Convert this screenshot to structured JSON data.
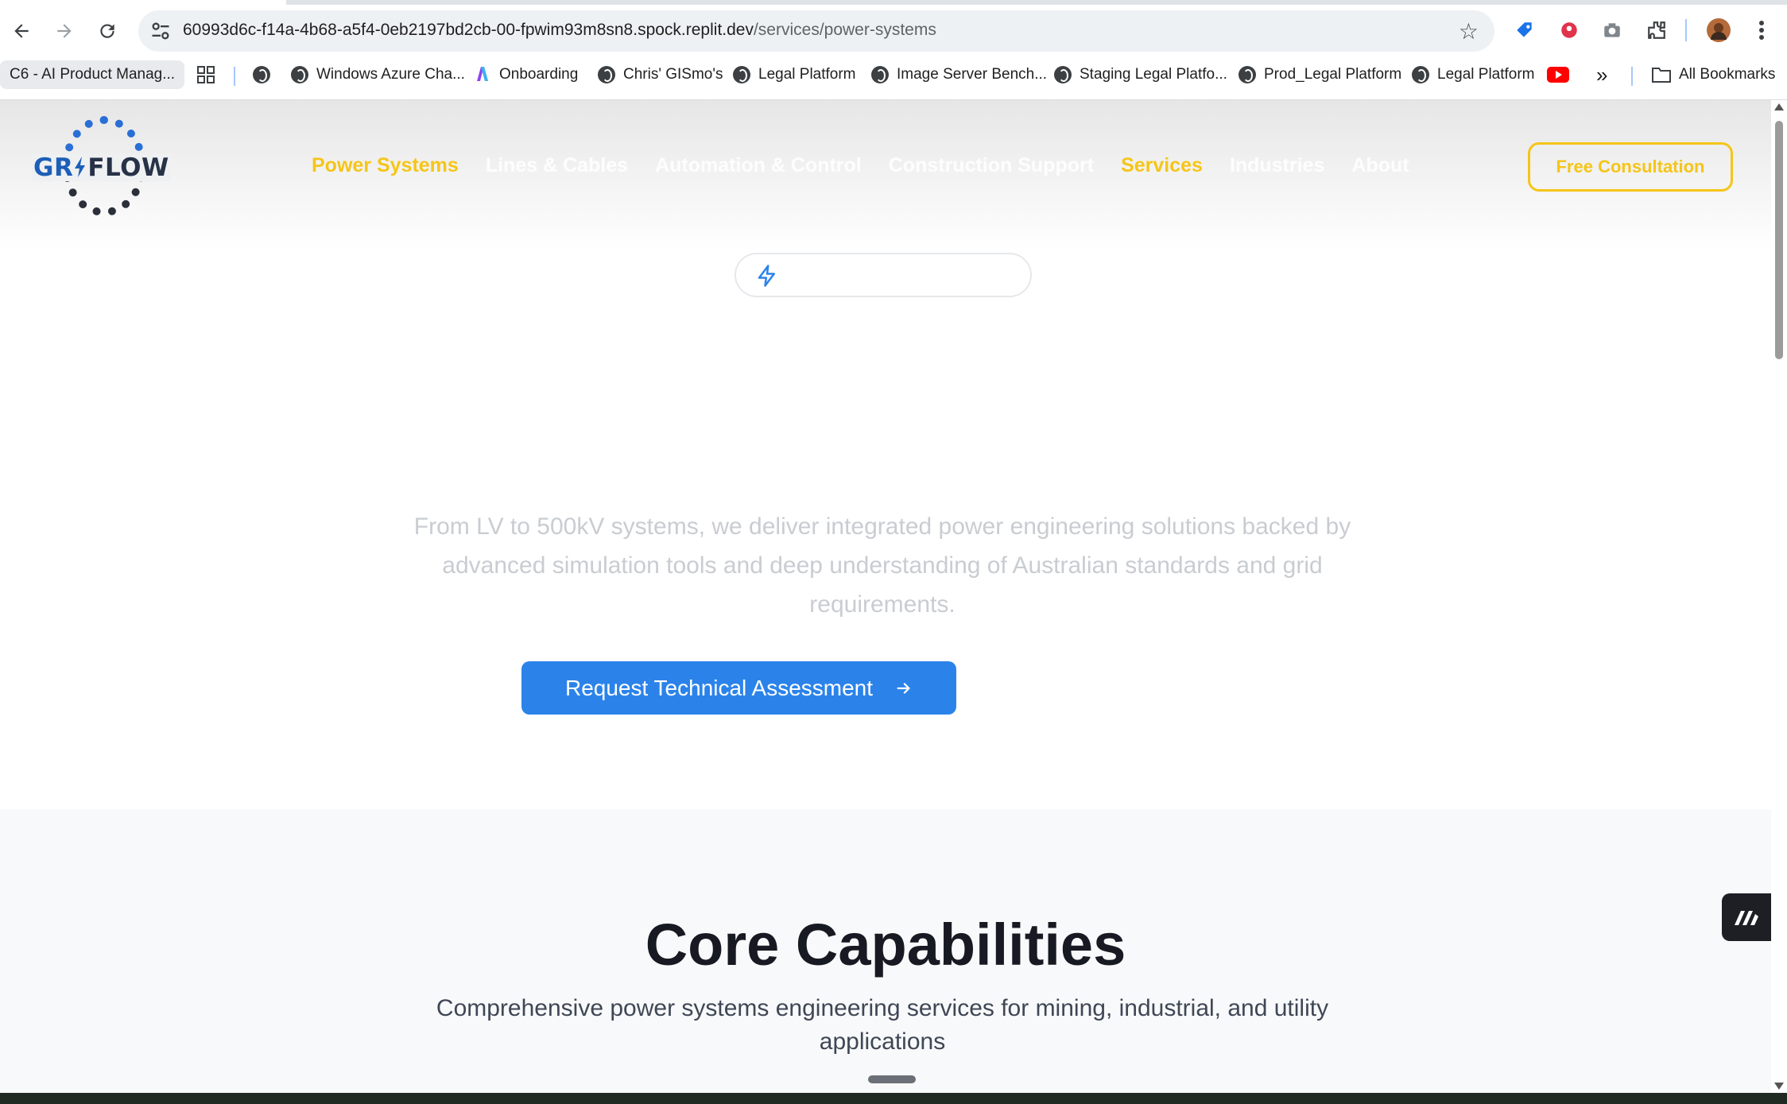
{
  "browser": {
    "url_host": "60993d6c-f14a-4b68-a5f4-0eb2197bd2cb-00-fpwim93m8sn8.spock.replit.dev",
    "url_path": "/services/power-systems",
    "tab_title": "C6 - AI Product Manag...",
    "bookmarks": [
      "Windows Azure Cha...",
      "Onboarding",
      "Chris' GISmo's",
      "Legal Platform",
      "Image Server Bench...",
      "Staging Legal Platfo...",
      "Prod_Legal Platform",
      "Legal Platform"
    ],
    "all_bookmarks": "All Bookmarks",
    "more_glyph": "»"
  },
  "site": {
    "logo_text_a": "GR",
    "logo_text_b": "FLOW",
    "nav": [
      "Power Systems",
      "Lines & Cables",
      "Automation & Control",
      "Construction Support",
      "Services",
      "Industries",
      "About"
    ],
    "consult_label": "Free Consultation",
    "hero_desc": "From LV to 500kV systems, we deliver integrated power engineering solutions backed by advanced simulation tools and deep understanding of Australian standards and grid requirements.",
    "cta_label": "Request Technical Assessment",
    "core_title": "Core Capabilities",
    "core_subtitle": "Comprehensive power systems engineering services for mining, industrial, and utility applications"
  },
  "colors": {
    "accent_yellow": "#f5c518",
    "cta_blue": "#2b83ea",
    "logo_blue": "#1c5fb8"
  },
  "icons": [
    "back-icon",
    "forward-icon",
    "reload-icon",
    "site-settings-icon",
    "bookmark-star-icon",
    "extensions-icon",
    "lightning-bolt-icon",
    "arrow-right-icon"
  ]
}
